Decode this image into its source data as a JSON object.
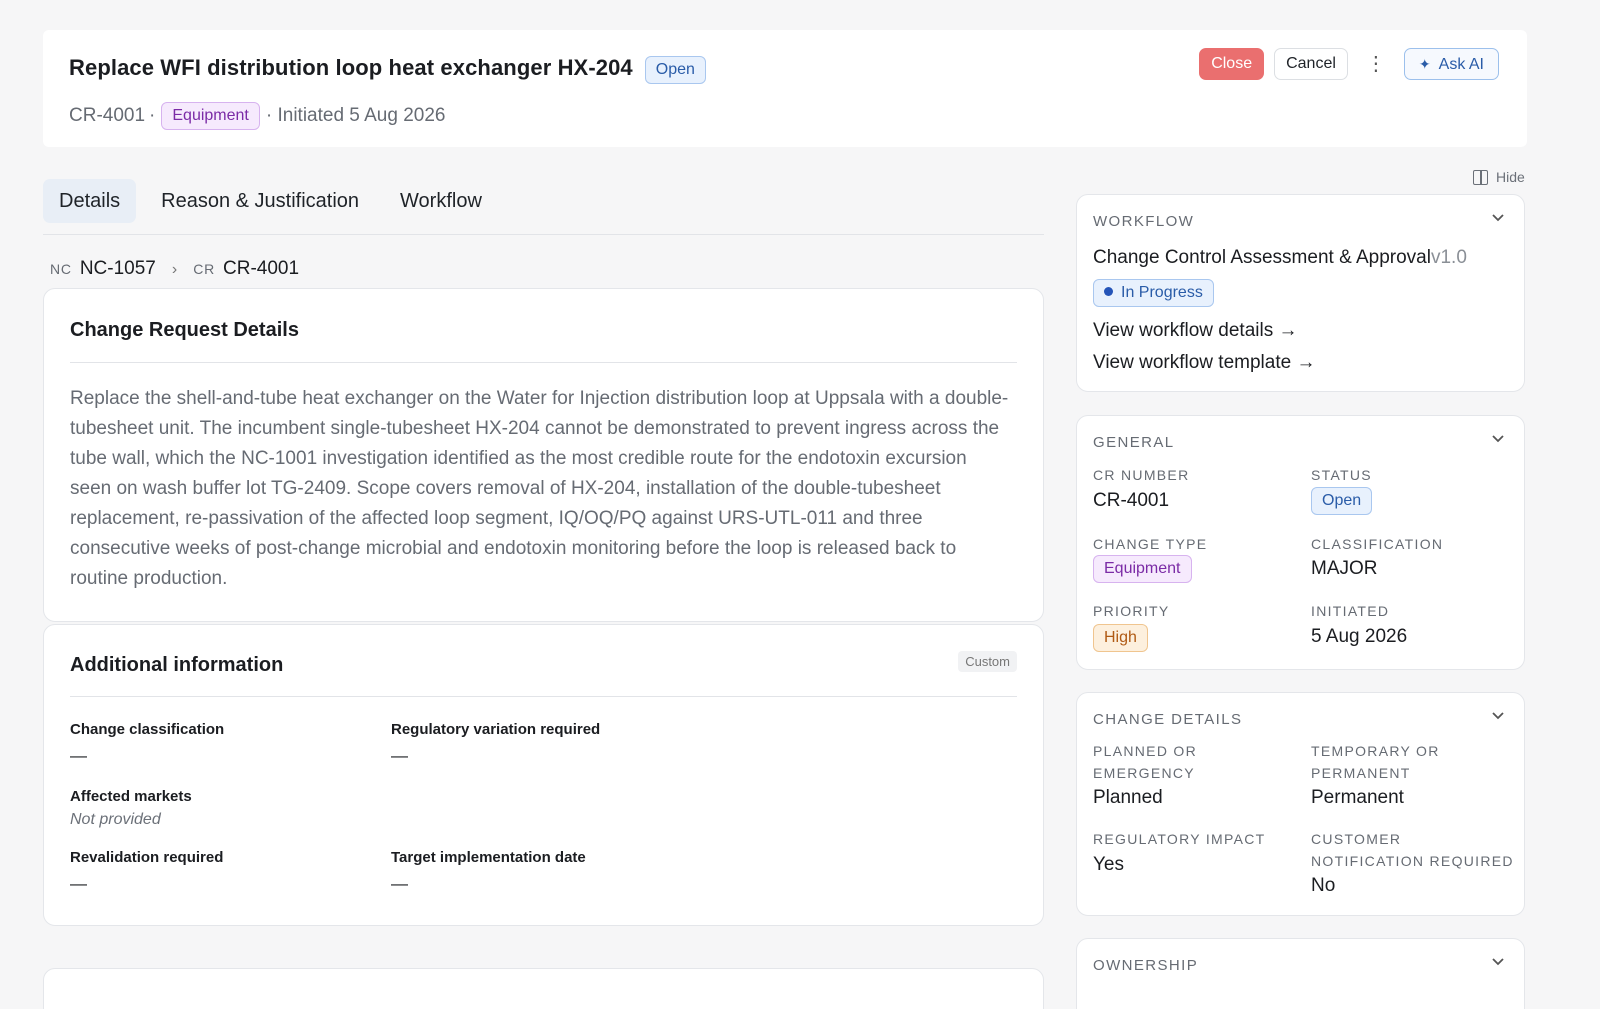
{
  "header": {
    "title": "Replace WFI distribution loop heat exchanger HX-204",
    "status": "Open",
    "id": "CR-4001",
    "sep1": "·",
    "type": "Equipment",
    "initiated": "· Initiated 5 Aug 2026",
    "actions": {
      "close": "Close",
      "cancel": "Cancel",
      "more": "⋮",
      "ask_ai": "Ask AI"
    }
  },
  "tabs": [
    "Details",
    "Reason & Justification",
    "Workflow"
  ],
  "breadcrumb": [
    {
      "prefix": "NC",
      "value": "NC-1057"
    },
    {
      "prefix": "CR",
      "value": "CR-4001"
    }
  ],
  "details_card": {
    "title": "Change Request Details",
    "description": "Replace the shell-and-tube heat exchanger on the Water for Injection distribution loop at Uppsala with a double-tubesheet unit. The incumbent single-tubesheet HX-204 cannot be demonstrated to prevent ingress across the tube wall, which the NC-1001 investigation identified as the most credible route for the endotoxin excursion seen on wash buffer lot TG-2409. Scope covers removal of HX-204, installation of the double-tubesheet replacement, re-passivation of the affected loop segment, IQ/OQ/PQ against URS-UTL-011 and three consecutive weeks of post-change microbial and endotoxin monitoring before the loop is released back to routine production."
  },
  "additional_card": {
    "title": "Additional information",
    "tag": "Custom",
    "fields": [
      {
        "label": "Change classification",
        "value": "—"
      },
      {
        "label": "Regulatory variation required",
        "value": "—"
      },
      {
        "label": "Affected markets",
        "value": "Not provided"
      },
      {
        "label": "Revalidation required",
        "value": "—"
      },
      {
        "label": "Target implementation date",
        "value": "—"
      }
    ]
  },
  "panel": {
    "hide": "Hide",
    "workflow": {
      "heading": "WORKFLOW",
      "name": "Change Control Assessment & Approval",
      "version": "v1.0",
      "status": "In Progress",
      "link_details": "View workflow details →",
      "link_template": "View workflow template →"
    },
    "general": {
      "heading": "GENERAL",
      "cr_number_label": "CR NUMBER",
      "cr_number": "CR-4001",
      "status_label": "STATUS",
      "status": "Open",
      "change_type_label": "CHANGE TYPE",
      "change_type": "Equipment",
      "classification_label": "CLASSIFICATION",
      "classification": "MAJOR",
      "priority_label": "PRIORITY",
      "priority": "High",
      "initiated_label": "INITIATED",
      "initiated": "5 Aug 2026"
    },
    "change_details": {
      "heading": "CHANGE DETAILS",
      "planned_label_1": "PLANNED OR",
      "planned_label_2": "EMERGENCY",
      "planned": "Planned",
      "temporary_label_1": "TEMPORARY OR",
      "temporary_label_2": "PERMANENT",
      "temporary": "Permanent",
      "regulatory_label": "REGULATORY IMPACT",
      "regulatory": "Yes",
      "customer_label_1": "CUSTOMER",
      "customer_label_2": "NOTIFICATION REQUIRED",
      "customer": "No"
    },
    "ownership": {
      "heading": "OWNERSHIP"
    }
  },
  "colors": {
    "close_button": "#ea6f6f",
    "open_badge": "#2a5ca8",
    "equipment_badge": "#7b2ba6",
    "high_badge": "#b05a14",
    "active_tab": "#e8eef6"
  }
}
